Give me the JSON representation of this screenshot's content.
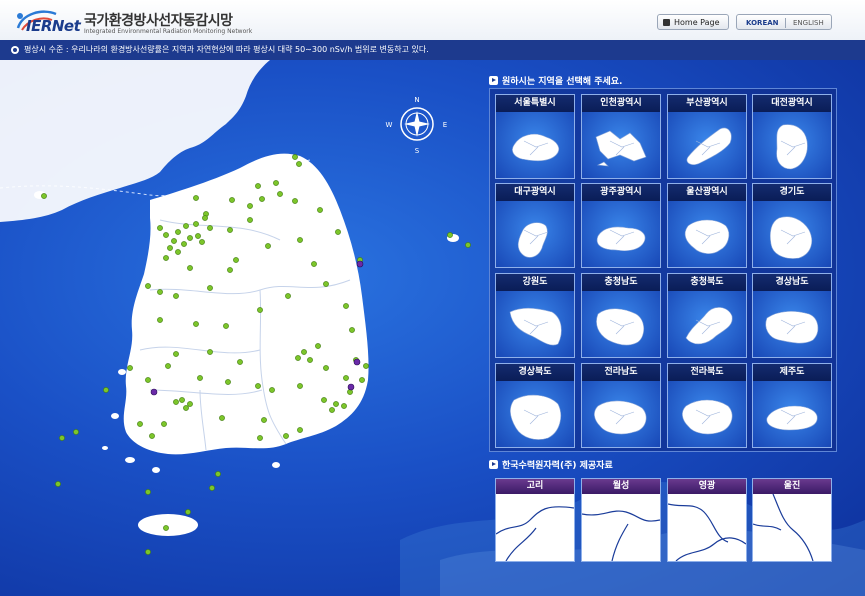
{
  "header": {
    "logo_text": "IERNet",
    "title": "국가환경방사선자동감시망",
    "subtitle": "Integrated Environmental Radiation Monitoring Network",
    "home_label": "Home Page",
    "lang_korean": "KOREAN",
    "lang_english": "ENGLISH"
  },
  "notice": {
    "text": "평상시 수준 : 우리나라의 환경방사선량률은 지역과 자연현상에 따라 평상시 대략 50∼300 nSv/h 범위로 변동하고 있다."
  },
  "compass": {
    "n": "N",
    "s": "S",
    "e": "E",
    "w": "W"
  },
  "regions": {
    "title": "원하시는 지역을 선택해 주세요.",
    "items": [
      {
        "label": "서울특별시"
      },
      {
        "label": "인천광역시"
      },
      {
        "label": "부산광역시"
      },
      {
        "label": "대전광역시"
      },
      {
        "label": "대구광역시"
      },
      {
        "label": "광주광역시"
      },
      {
        "label": "울산광역시"
      },
      {
        "label": "경기도"
      },
      {
        "label": "강원도"
      },
      {
        "label": "충청남도"
      },
      {
        "label": "충청북도"
      },
      {
        "label": "경상남도"
      },
      {
        "label": "경상북도"
      },
      {
        "label": "전라남도"
      },
      {
        "label": "전라북도"
      },
      {
        "label": "제주도"
      }
    ]
  },
  "nuclear": {
    "title": "한국수력원자력(주) 제공자료",
    "items": [
      {
        "label": "고리"
      },
      {
        "label": "월성"
      },
      {
        "label": "영광"
      },
      {
        "label": "울진"
      }
    ]
  },
  "colors": {
    "station_dot": "#7cc52a",
    "nuclear_dot": "#6a2aa8",
    "header_bar": "#1d3a8e",
    "region_label_bg": "#0a1d57",
    "nuclear_label_bg": "#4a2378"
  }
}
